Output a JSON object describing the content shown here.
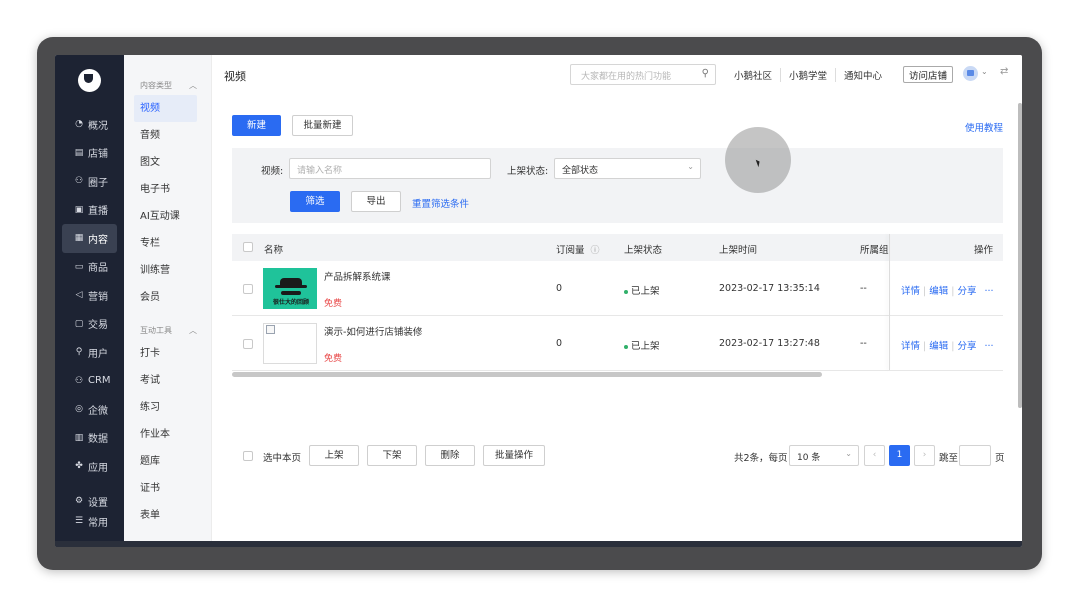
{
  "sidebar": {
    "items": [
      {
        "icon": "pie-chart-icon",
        "glyph": "◔",
        "label": "概况"
      },
      {
        "icon": "store-icon",
        "glyph": "▤",
        "label": "店铺"
      },
      {
        "icon": "people-icon",
        "glyph": "⚇",
        "label": "圈子"
      },
      {
        "icon": "live-icon",
        "glyph": "▣",
        "label": "直播"
      },
      {
        "icon": "content-icon",
        "glyph": "▦",
        "label": "内容"
      },
      {
        "icon": "goods-icon",
        "glyph": "▭",
        "label": "商品"
      },
      {
        "icon": "marketing-icon",
        "glyph": "◁",
        "label": "营销"
      },
      {
        "icon": "trade-icon",
        "glyph": "▢",
        "label": "交易"
      },
      {
        "icon": "user-icon",
        "glyph": "⚲",
        "label": "用户"
      },
      {
        "icon": "crm-icon",
        "glyph": "⚇",
        "label": "CRM"
      },
      {
        "icon": "wecom-icon",
        "glyph": "◎",
        "label": "企微"
      },
      {
        "icon": "data-icon",
        "glyph": "▥",
        "label": "数据"
      },
      {
        "icon": "apps-icon",
        "glyph": "✤",
        "label": "应用"
      }
    ],
    "bottom": [
      {
        "icon": "settings-icon",
        "glyph": "⚙",
        "label": "设置"
      },
      {
        "icon": "common-icon",
        "glyph": "☰",
        "label": "常用"
      }
    ],
    "active_index": 4
  },
  "subnav": {
    "group1": "内容类型",
    "items1": [
      "视频",
      "音频",
      "图文",
      "电子书",
      "AI互动课",
      "专栏",
      "训练营",
      "会员"
    ],
    "group2": "互动工具",
    "items2": [
      "打卡",
      "考试",
      "练习",
      "作业本",
      "题库",
      "证书",
      "表单"
    ]
  },
  "topbar": {
    "title": "视频",
    "search_placeholder": "大家都在用的热门功能",
    "links": [
      "小鹅社区",
      "小鹅学堂",
      "通知中心"
    ],
    "visit_store": "访问店铺"
  },
  "actions": {
    "new": "新建",
    "batch_new": "批量新建",
    "tutorial": "使用教程"
  },
  "filter": {
    "video_label": "视频:",
    "video_placeholder": "请输入名称",
    "status_label": "上架状态:",
    "status_value": "全部状态",
    "filter_btn": "筛选",
    "export_btn": "导出",
    "reset_link": "重置筛选条件"
  },
  "table": {
    "headers": {
      "name": "名称",
      "subs": "订阅量",
      "status": "上架状态",
      "time": "上架时间",
      "group": "所属组",
      "ops": "操作"
    },
    "rows": [
      {
        "title": "产品拆解系统课",
        "price": "免费",
        "subs": "0",
        "status": "已上架",
        "time": "2023-02-17 13:35:14",
        "group": "--",
        "thumb_caption": "很仕大的回顾"
      },
      {
        "title": "演示-如何进行店铺装修",
        "price": "免费",
        "subs": "0",
        "status": "已上架",
        "time": "2023-02-17 13:27:48",
        "group": "--"
      }
    ],
    "ops": {
      "detail": "详情",
      "edit": "编辑",
      "share": "分享",
      "more": "···"
    }
  },
  "footer": {
    "select_page": "选中本页",
    "on_shelf": "上架",
    "off_shelf": "下架",
    "delete": "删除",
    "batch_ops": "批量操作",
    "total": "共2条，每页",
    "page_size": "10 条",
    "current_page": "1",
    "jump_to": "跳至",
    "page_unit": "页"
  }
}
